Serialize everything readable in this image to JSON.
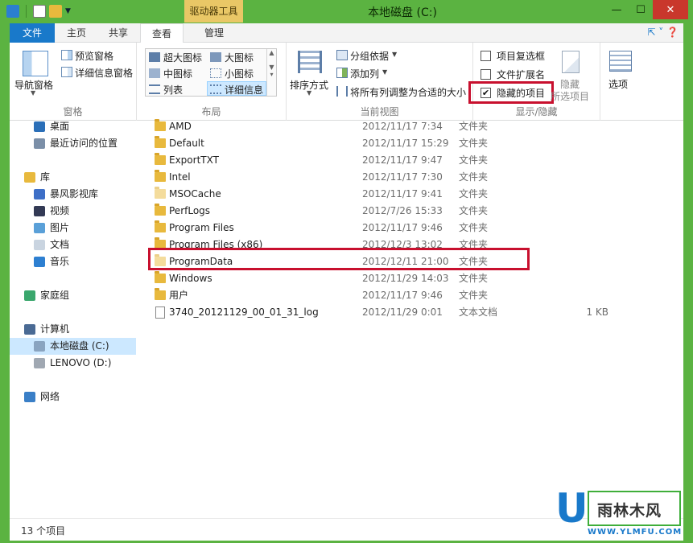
{
  "window": {
    "title": "本地磁盘 (C:)",
    "context_tab_group": "驱动器工具"
  },
  "tabs": [
    {
      "label": "文件",
      "active": false
    },
    {
      "label": "主页",
      "active": false
    },
    {
      "label": "共享",
      "active": false
    },
    {
      "label": "查看",
      "active": true
    },
    {
      "label": "管理",
      "active": false
    }
  ],
  "ribbon": {
    "panes": {
      "label": "窗格",
      "nav_pane": "导航窗格",
      "preview_pane": "预览窗格",
      "details_pane": "详细信息窗格"
    },
    "layout": {
      "label": "布局",
      "items": [
        "超大图标",
        "大图标",
        "中图标",
        "小图标",
        "列表",
        "详细信息"
      ],
      "selected": "详细信息"
    },
    "current_view": {
      "label": "当前视图",
      "sort_by": "排序方式",
      "group_by": "分组依据",
      "add_columns": "添加列",
      "fit_columns": "将所有列调整为合适的大小"
    },
    "show_hide": {
      "label": "显示/隐藏",
      "item_checkboxes": {
        "label": "项目复选框",
        "checked": false
      },
      "file_extensions": {
        "label": "文件扩展名",
        "checked": false
      },
      "hidden_items": {
        "label": "隐藏的项目",
        "checked": true
      },
      "hide_selected": "隐藏",
      "hide_selected_sub": "所选项目"
    },
    "options": "选项"
  },
  "nav": [
    {
      "label": "桌面",
      "indent": 1,
      "icon": "desktop-icon",
      "selected": false
    },
    {
      "label": "最近访问的位置",
      "indent": 1,
      "icon": "recent-places-icon",
      "selected": false
    },
    {
      "label": "库",
      "indent": 0,
      "icon": "library-icon",
      "selected": false
    },
    {
      "label": "暴风影视库",
      "indent": 1,
      "icon": "video-library-icon",
      "selected": false
    },
    {
      "label": "视频",
      "indent": 1,
      "icon": "videos-icon",
      "selected": false
    },
    {
      "label": "图片",
      "indent": 1,
      "icon": "pictures-icon",
      "selected": false
    },
    {
      "label": "文档",
      "indent": 1,
      "icon": "documents-icon",
      "selected": false
    },
    {
      "label": "音乐",
      "indent": 1,
      "icon": "music-icon",
      "selected": false
    },
    {
      "label": "家庭组",
      "indent": 0,
      "icon": "homegroup-icon",
      "selected": false
    },
    {
      "label": "计算机",
      "indent": 0,
      "icon": "computer-icon",
      "selected": false
    },
    {
      "label": "本地磁盘 (C:)",
      "indent": 1,
      "icon": "drive-c-icon",
      "selected": true
    },
    {
      "label": "LENOVO (D:)",
      "indent": 1,
      "icon": "drive-d-icon",
      "selected": false
    },
    {
      "label": "网络",
      "indent": 0,
      "icon": "network-icon",
      "selected": false
    }
  ],
  "files": [
    {
      "name": "AMD",
      "date": "2012/11/17 7:34",
      "type": "文件夹",
      "size": "",
      "kind": "folder",
      "hidden": false
    },
    {
      "name": "Default",
      "date": "2012/11/17 15:29",
      "type": "文件夹",
      "size": "",
      "kind": "folder",
      "hidden": false
    },
    {
      "name": "ExportTXT",
      "date": "2012/11/17 9:47",
      "type": "文件夹",
      "size": "",
      "kind": "folder",
      "hidden": false
    },
    {
      "name": "Intel",
      "date": "2012/11/17 7:30",
      "type": "文件夹",
      "size": "",
      "kind": "folder",
      "hidden": false
    },
    {
      "name": "MSOCache",
      "date": "2012/11/17 9:41",
      "type": "文件夹",
      "size": "",
      "kind": "folder",
      "hidden": true
    },
    {
      "name": "PerfLogs",
      "date": "2012/7/26 15:33",
      "type": "文件夹",
      "size": "",
      "kind": "folder",
      "hidden": false
    },
    {
      "name": "Program Files",
      "date": "2012/11/17 9:46",
      "type": "文件夹",
      "size": "",
      "kind": "folder",
      "hidden": false
    },
    {
      "name": "Program Files (x86)",
      "date": "2012/12/3 13:02",
      "type": "文件夹",
      "size": "",
      "kind": "folder",
      "hidden": false
    },
    {
      "name": "ProgramData",
      "date": "2012/12/11 21:00",
      "type": "文件夹",
      "size": "",
      "kind": "folder",
      "hidden": true
    },
    {
      "name": "Windows",
      "date": "2012/11/29 14:03",
      "type": "文件夹",
      "size": "",
      "kind": "folder",
      "hidden": false
    },
    {
      "name": "用户",
      "date": "2012/11/17 9:46",
      "type": "文件夹",
      "size": "",
      "kind": "folder",
      "hidden": false
    },
    {
      "name": "3740_20121129_00_01_31_log",
      "date": "2012/11/29 0:01",
      "type": "文本文档",
      "size": "1 KB",
      "kind": "file",
      "hidden": false
    }
  ],
  "status": {
    "item_count": "13 个项目"
  },
  "watermark": {
    "letter": "U",
    "brand": "雨林木风",
    "url": "WWW.YLMFU.COM"
  },
  "colors": {
    "titlebar": "#5bb341",
    "file_tab": "#1979ca",
    "context_tab": "#e9c766",
    "highlight": "#c8102e",
    "selection": "#cce8ff"
  }
}
